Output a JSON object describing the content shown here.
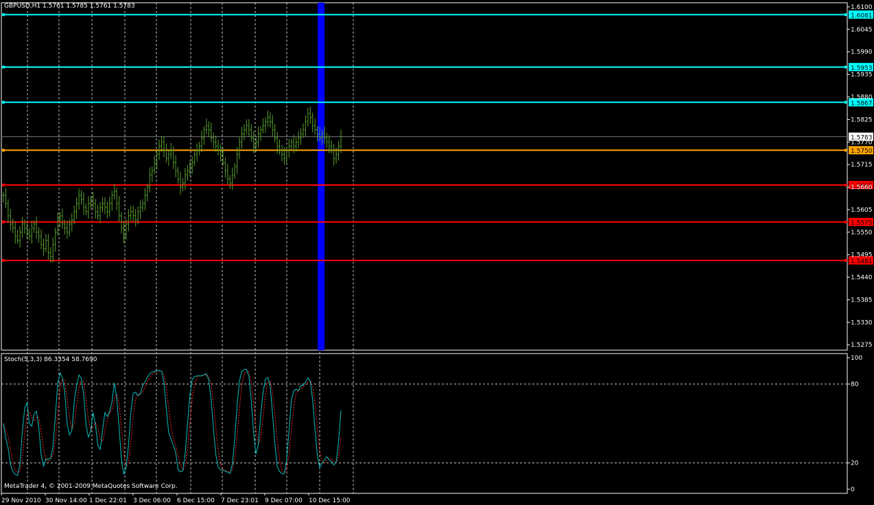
{
  "header": {
    "symbol_info": "GBPUSD,H1  1.5761 1.5785 1.5761 1.5783",
    "indicator_info": "Stoch(5,3,3) 86.3354 58.7690",
    "copyright": "MetaTrader 4, © 2001-2009 MetaQuotes Software Corp."
  },
  "colors": {
    "background": "#000000",
    "grid": "#c8c8c8",
    "candles": "#58a12f",
    "resistance": "#00ffff",
    "pivot": "#ffa500",
    "support": "#ff0000",
    "highlight_band": "#0000ff",
    "stoch_main": "#00bfbf",
    "stoch_signal": "#ff2a2a",
    "price_tag_text": "#000000"
  },
  "chart_data": [
    {
      "type": "line",
      "panel": "price",
      "ylim": [
        1.5262,
        1.611
      ],
      "y_ticks": [
        "1.6100",
        "1.6045",
        "1.5990",
        "1.5935",
        "1.5880",
        "1.5825",
        "1.5770",
        "1.5715",
        "1.5660",
        "1.5605",
        "1.5550",
        "1.5495",
        "1.5440",
        "1.5385",
        "1.5330",
        "1.5275"
      ],
      "x_ticks": [
        "29 Nov 2010",
        "30 Nov 14:00",
        "1 Dec 22:01",
        "3 Dec 06:00",
        "6 Dec 15:00",
        "7 Dec 23:01",
        "9 Dec 07:00",
        "10 Dec 15:00"
      ],
      "current_price": {
        "value": 1.5783,
        "label": "1.5783"
      },
      "horizontal_lines": [
        {
          "value": 1.6081,
          "label": "1.6081",
          "kind": "resistance"
        },
        {
          "value": 1.5953,
          "label": "1.5953",
          "kind": "resistance"
        },
        {
          "value": 1.5867,
          "label": "1.5867",
          "kind": "resistance"
        },
        {
          "value": 1.575,
          "label": "1.5750",
          "kind": "pivot"
        },
        {
          "value": 1.5665,
          "label": "1.5665",
          "kind": "support"
        },
        {
          "value": 1.5575,
          "label": "1.5575",
          "kind": "support"
        },
        {
          "value": 1.5481,
          "label": "1.5481",
          "kind": "support"
        }
      ],
      "series": [
        {
          "style": "bars",
          "close": [
            1.564,
            1.562,
            1.559,
            1.557,
            1.556,
            1.554,
            1.553,
            1.555,
            1.557,
            1.556,
            1.555,
            1.554,
            1.556,
            1.557,
            1.555,
            1.554,
            1.552,
            1.551,
            1.553,
            1.55,
            1.549,
            1.552,
            1.555,
            1.558,
            1.559,
            1.557,
            1.556,
            1.555,
            1.557,
            1.558,
            1.56,
            1.562,
            1.564,
            1.563,
            1.561,
            1.56,
            1.562,
            1.563,
            1.562,
            1.56,
            1.559,
            1.561,
            1.562,
            1.561,
            1.56,
            1.562,
            1.564,
            1.565,
            1.562,
            1.559,
            1.556,
            1.554,
            1.557,
            1.559,
            1.56,
            1.559,
            1.558,
            1.56,
            1.561,
            1.562,
            1.564,
            1.566,
            1.569,
            1.57,
            1.572,
            1.574,
            1.576,
            1.577,
            1.575,
            1.573,
            1.574,
            1.575,
            1.572,
            1.57,
            1.568,
            1.566,
            1.567,
            1.569,
            1.57,
            1.571,
            1.572,
            1.574,
            1.575,
            1.576,
            1.578,
            1.58,
            1.581,
            1.58,
            1.578,
            1.577,
            1.576,
            1.575,
            1.574,
            1.572,
            1.57,
            1.568,
            1.567,
            1.569,
            1.571,
            1.574,
            1.577,
            1.579,
            1.58,
            1.581,
            1.58,
            1.578,
            1.576,
            1.577,
            1.579,
            1.58,
            1.581,
            1.582,
            1.583,
            1.582,
            1.58,
            1.578,
            1.576,
            1.575,
            1.574,
            1.573,
            1.575,
            1.576,
            1.577,
            1.576,
            1.577,
            1.578,
            1.579,
            1.58,
            1.582,
            1.584,
            1.583,
            1.581,
            1.58,
            1.579,
            1.578,
            1.579,
            1.578,
            1.577,
            1.576,
            1.575,
            1.573,
            1.574,
            1.576,
            1.5783
          ]
        },
        {
          "name": "Stoch(5,3,3)",
          "panel": "stochastic",
          "ylim": [
            0,
            100
          ],
          "y_ticks": [
            "100",
            "80",
            "20",
            "0"
          ],
          "levels": [
            80,
            20
          ]
        }
      ]
    }
  ]
}
